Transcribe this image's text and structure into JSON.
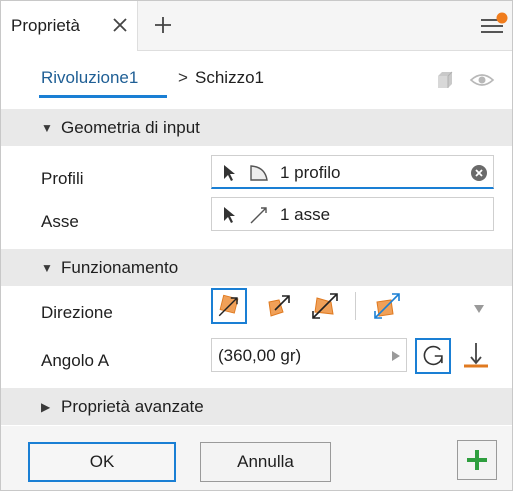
{
  "tab": {
    "label": "Proprietà"
  },
  "breadcrumb": {
    "parent": "Rivoluzione1",
    "separator": ">",
    "current": "Schizzo1"
  },
  "sections": {
    "input_geometry": "Geometria di input",
    "behavior": "Funzionamento",
    "advanced": "Proprietà avanzate"
  },
  "fields": {
    "profiles": {
      "label": "Profili",
      "value": "1 profilo"
    },
    "axis": {
      "label": "Asse",
      "value": "1 asse"
    },
    "direction": {
      "label": "Direzione",
      "selected": "direction-1"
    },
    "angle": {
      "label": "Angolo A",
      "value": "(360,00 gr)"
    }
  },
  "footer": {
    "ok": "OK",
    "cancel": "Annulla"
  },
  "colors": {
    "accent": "#1a7fd4",
    "orange": "#f08c2c",
    "green": "#2e9e3e",
    "notification": "#f07c1c"
  },
  "icons": [
    "close-icon",
    "plus-icon",
    "menu-icon",
    "cube-icon",
    "eye-icon",
    "cursor-icon",
    "profile-shape-icon",
    "axis-line-icon",
    "clear-icon",
    "direction-icon",
    "rotate-icon",
    "flip-icon"
  ]
}
